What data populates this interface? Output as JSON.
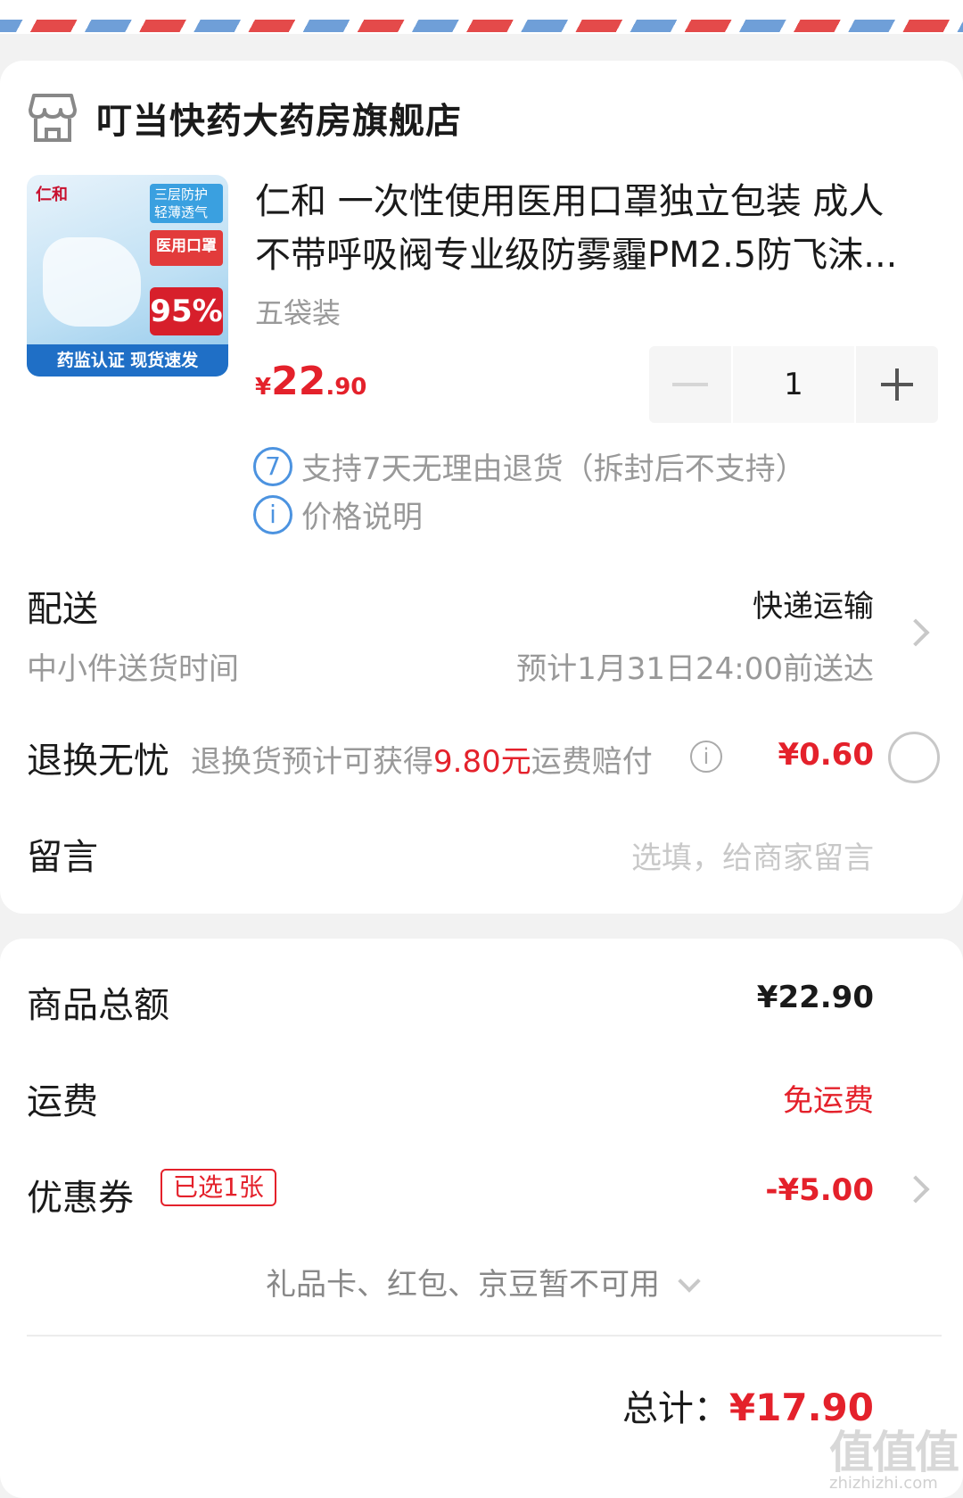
{
  "shop": {
    "name": "叮当快药大药房旗舰店",
    "icon": "store-icon"
  },
  "product": {
    "image": {
      "brand": "仁和",
      "badge_blue": "三层防护 轻薄透气",
      "badge_red": "医用口罩",
      "badge_pct": "95%",
      "footer": "药监认证 现货速发"
    },
    "title": "仁和 一次性使用医用口罩独立包装 成人不带呼吸阀专业级防雾霾PM2.5防飞沫...",
    "spec": "五袋装",
    "price": {
      "currency": "¥",
      "integer": "22",
      "decimal": ".90"
    },
    "quantity": "1",
    "services": [
      {
        "icon_text": "7",
        "text": "支持7天无理由退货（拆封后不支持）"
      },
      {
        "icon_text": "i",
        "text": "价格说明"
      }
    ]
  },
  "delivery": {
    "label": "配送",
    "method": "快递运输",
    "sub_label": "中小件送货时间",
    "eta": "预计1月31日24:00前送达"
  },
  "return_insurance": {
    "label": "退换无忧",
    "desc_prefix": "退换货预计可获得",
    "desc_highlight": "9.80元",
    "desc_suffix": "运费赔付",
    "price": "¥0.60"
  },
  "message": {
    "label": "留言",
    "placeholder": "选填，给商家留言"
  },
  "summary": {
    "goods_total_label": "商品总额",
    "goods_total": "¥22.90",
    "shipping_label": "运费",
    "shipping_value": "免运费",
    "coupon_label": "优惠券",
    "coupon_tag": "已选1张",
    "coupon_value": "-¥5.00",
    "gift_text": "礼品卡、红包、京豆暂不可用",
    "total_label": "总计：",
    "total_value": "¥17.90"
  },
  "watermark": {
    "text": "值值值",
    "url": "zhizhizhi.com"
  },
  "colors": {
    "accent_red": "#e4212b",
    "info_blue": "#4c93e0",
    "muted": "#999999"
  }
}
